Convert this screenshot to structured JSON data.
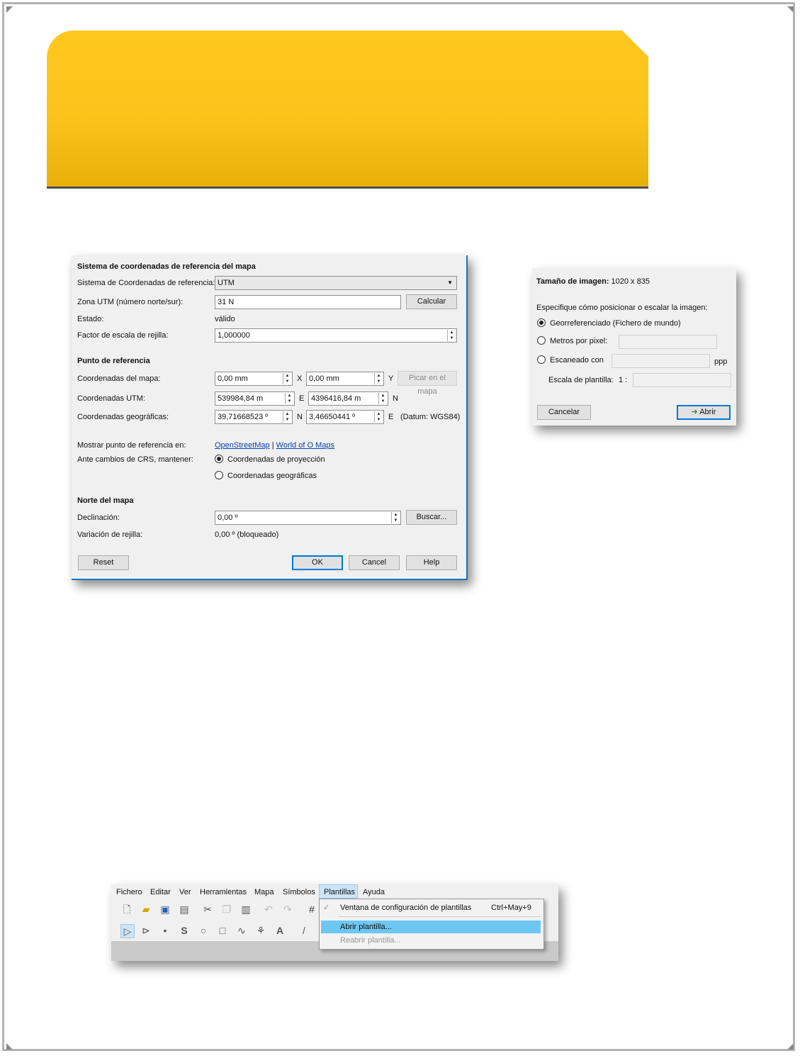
{
  "dialog_crs": {
    "section_crs": "Sistema de coordenadas de referencia del mapa",
    "crs_label": "Sistema de Coordenadas de referencia:",
    "crs_value": "UTM",
    "utm_zone_label": "Zona UTM (número norte/sur):",
    "utm_zone_value": "31 N",
    "calc_button": "Calcular",
    "status_label": "Estado:",
    "status_value": "válido",
    "scale_label": "Factor de escala de rejilla:",
    "scale_value": "1,000000",
    "section_ref": "Punto de referencia",
    "map_coords_label": "Coordenadas del mapa:",
    "map_x": "0,00 mm",
    "map_x_axis": "X",
    "map_y": "0,00 mm",
    "map_y_axis": "Y",
    "pick_button": "Picar en el mapa",
    "utm_coords_label": "Coordenadas UTM:",
    "utm_e_value": "539984,84 m",
    "utm_e_axis": "E",
    "utm_n_value": "4396416,84 m",
    "utm_n_axis": "N",
    "geo_coords_label": "Coordenadas geográficas:",
    "geo_lat": "39,71668523 º",
    "geo_lat_axis": "N",
    "geo_lon": "3,46650441 º",
    "geo_lon_axis": "E",
    "datum": "(Datum: WGS84)",
    "show_ref_label": "Mostrar punto de referencia en:",
    "link_osm": "OpenStreetMap",
    "link_sep": "|",
    "link_woo": "World of O Maps",
    "crs_change_label": "Ante cambios de CRS, mantener:",
    "radio_projection": "Coordenadas de proyección",
    "radio_geographic": "Coordenadas geográficas",
    "section_north": "Norte del mapa",
    "declination_label": "Declinación:",
    "declination_value": "0,00 º",
    "search_button": "Buscar...",
    "grid_var_label": "Variación de rejilla:",
    "grid_var_value": "0,00 º (bloqueado)",
    "reset_button": "Reset",
    "ok_button": "OK",
    "cancel_button": "Cancel",
    "help_button": "Help"
  },
  "dialog_image": {
    "size_label": "Tamaño de imagen:",
    "size_value": "1020 x 835",
    "instruction": "Especifique cómo posicionar o escalar la imagen:",
    "radio_georef": "Georreferenciado (Fichero de mundo)",
    "radio_meters": "Metros por pixel:",
    "radio_scanned": "Escaneado con",
    "ppp": "ppp",
    "template_scale_label": "Escala de plantilla:",
    "template_scale_prefix": "1 :",
    "cancel_button": "Cancelar",
    "open_button": "Abrir"
  },
  "menu_screenshot": {
    "menu": [
      "Fichero",
      "Editar",
      "Ver",
      "Herramientas",
      "Mapa",
      "Símbolos",
      "Plantillas",
      "Ayuda"
    ],
    "dropdown": {
      "item1": "Ventana de configuración de plantillas",
      "item1_shortcut": "Ctrl+May+9",
      "item2": "Abrir plantilla...",
      "item3": "Reabrir plantilla..."
    }
  },
  "colors": {
    "banner": "#fcc31b",
    "highlight": "#6ec6f2",
    "accent": "#0078d7"
  }
}
